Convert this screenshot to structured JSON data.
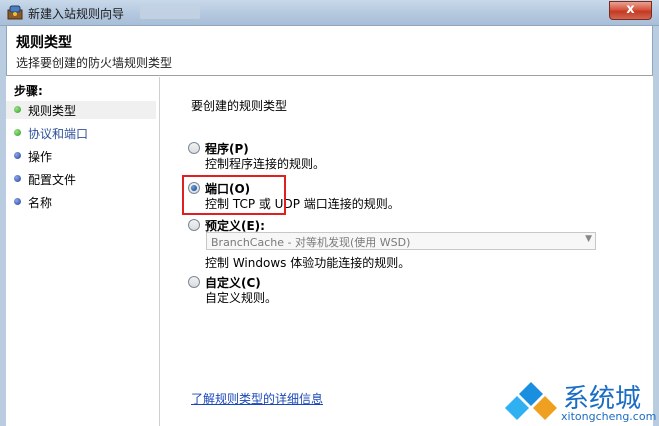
{
  "window": {
    "title": "新建入站规则向导",
    "close_label": "x"
  },
  "header": {
    "title": "规则类型",
    "subtitle": "选择要创建的防火墙规则类型"
  },
  "steps": {
    "label": "步骤:",
    "items": [
      {
        "label": "规则类型",
        "status": "green",
        "active": true
      },
      {
        "label": "协议和端口",
        "status": "green",
        "active": false
      },
      {
        "label": "操作",
        "status": "blue",
        "active": false
      },
      {
        "label": "配置文件",
        "status": "blue",
        "active": false
      },
      {
        "label": "名称",
        "status": "blue",
        "active": false
      }
    ]
  },
  "main": {
    "question": "要创建的规则类型",
    "options": [
      {
        "title": "程序(P)",
        "desc": "控制程序连接的规则。",
        "checked": false
      },
      {
        "title": "端口(O)",
        "desc": "控制 TCP 或 UDP 端口连接的规则。",
        "checked": true
      },
      {
        "title": "预定义(E):",
        "desc": "控制 Windows 体验功能连接的规则。",
        "checked": false
      },
      {
        "title": "自定义(C)",
        "desc": "自定义规则。",
        "checked": false
      }
    ],
    "predefined_select": "BranchCache - 对等机发现(使用 WSD)",
    "learn_link": "了解规则类型的详细信息"
  },
  "watermark": {
    "text": "系统城",
    "url": "xitongcheng.com"
  },
  "colors": {
    "highlight": "#e02020",
    "link": "#1a47b8"
  }
}
